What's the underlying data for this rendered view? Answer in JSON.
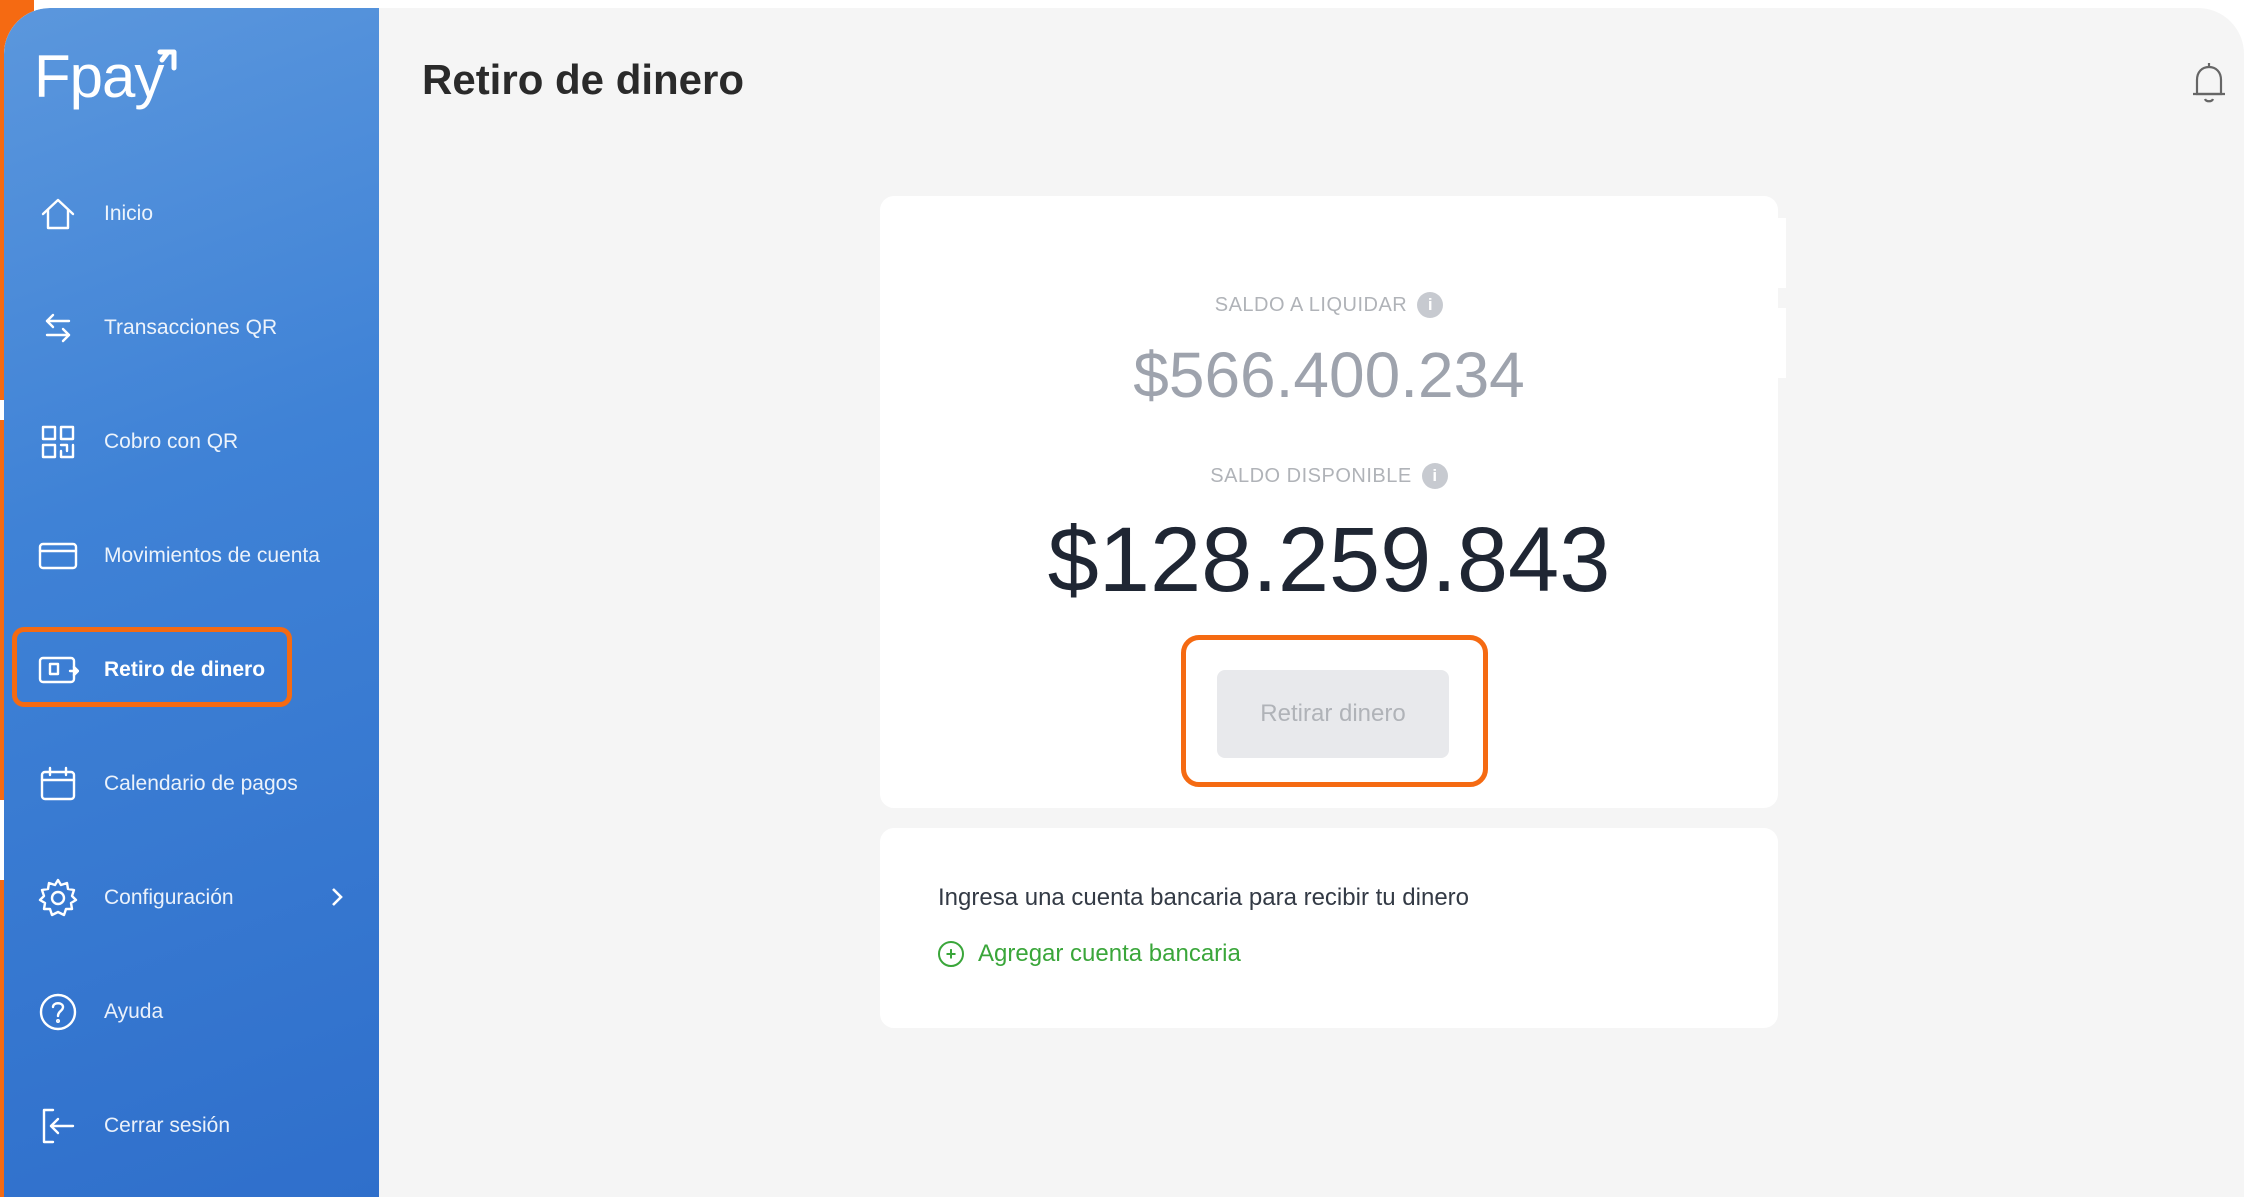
{
  "app": {
    "logo_text": "Fpay"
  },
  "sidebar": {
    "items": [
      {
        "label": "Inicio",
        "icon": "home-icon"
      },
      {
        "label": "Transacciones QR",
        "icon": "swap-arrows-icon"
      },
      {
        "label": "Cobro con QR",
        "icon": "qr-code-icon"
      },
      {
        "label": "Movimientos de cuenta",
        "icon": "card-icon"
      },
      {
        "label": "Retiro de dinero",
        "icon": "cash-withdraw-icon",
        "active": true
      },
      {
        "label": "Calendario de pagos",
        "icon": "calendar-icon"
      },
      {
        "label": "Configuración",
        "icon": "gear-icon",
        "has_submenu": true
      },
      {
        "label": "Ayuda",
        "icon": "help-icon"
      },
      {
        "label": "Cerrar sesión",
        "icon": "logout-icon"
      }
    ]
  },
  "header": {
    "title": "Retiro de dinero",
    "notification_icon": "bell-icon"
  },
  "balance": {
    "to_settle_label": "SALDO A LIQUIDAR",
    "to_settle_amount": "$566.400.234",
    "available_label": "SALDO DISPONIBLE",
    "available_amount": "$128.259.843",
    "info_icon_glyph": "i",
    "withdraw_button": "Retirar dinero"
  },
  "bank": {
    "prompt": "Ingresa una cuenta bancaria para recibir tu dinero",
    "add_label": "Agregar cuenta bancaria",
    "add_icon_glyph": "+"
  },
  "colors": {
    "sidebar_blue": "#3f82d6",
    "highlight_orange": "#f56a12",
    "link_green": "#3aa63a"
  }
}
